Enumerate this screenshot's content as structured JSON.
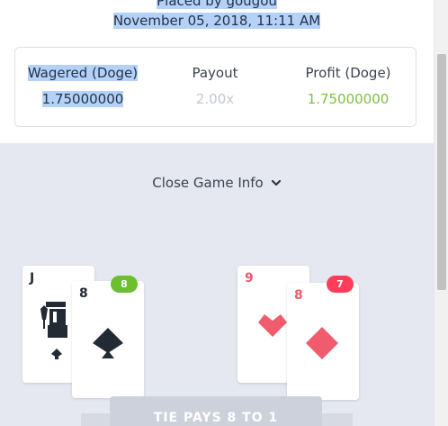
{
  "header": {
    "placed_by": "Placed by gougou",
    "date": "November 05, 2018, 11:11 AM"
  },
  "stats": {
    "wagered_label": "Wagered (Doge)",
    "wagered_value": "1.75000000",
    "payout_label": "Payout",
    "payout_value": "2.00x",
    "profit_label": "Profit (Doge)",
    "profit_value": "1.75000000"
  },
  "game": {
    "close_info_label": "Close Game Info",
    "player_hand": {
      "total": "8",
      "cards": [
        {
          "rank": "J",
          "suit": "spades"
        },
        {
          "rank": "8",
          "suit": "spades"
        }
      ]
    },
    "banker_hand": {
      "total": "7",
      "cards": [
        {
          "rank": "9",
          "suit": "hearts"
        },
        {
          "rank": "8",
          "suit": "diamonds"
        }
      ]
    },
    "tie_banner": "TIE PAYS 8 TO 1"
  },
  "colors": {
    "profit_green": "#7ac142",
    "badge_green": "#6cbf2f",
    "badge_red": "#ff3d5a",
    "card_red": "#f05b6e",
    "game_bg": "#e5e8f1",
    "selection": "#b4d2f7"
  }
}
